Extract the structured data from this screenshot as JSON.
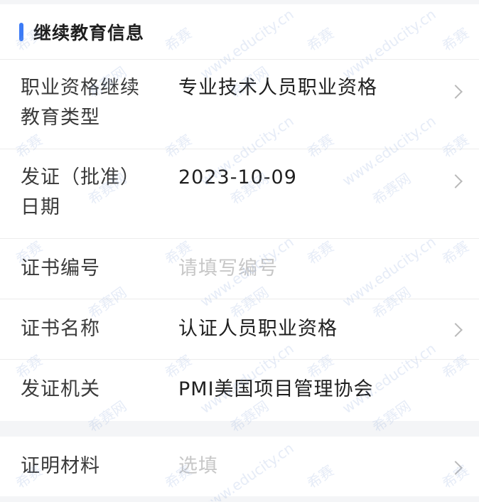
{
  "section": {
    "title": "继续教育信息"
  },
  "rows": [
    {
      "label_line1": "职业资格继续",
      "label_line2": "教育类型",
      "value": "专业技术人员职业资格",
      "has_chevron": true,
      "placeholder": false
    },
    {
      "label_line1": "发证（批准）",
      "label_line2": "日期",
      "value": "2023-10-09",
      "has_chevron": true,
      "placeholder": false
    },
    {
      "label_line1": "证书编号",
      "label_line2": "",
      "value": "请填写编号",
      "has_chevron": false,
      "placeholder": true
    },
    {
      "label_line1": "证书名称",
      "label_line2": "",
      "value": "认证人员职业资格",
      "has_chevron": true,
      "placeholder": false
    },
    {
      "label_line1": "发证机关",
      "label_line2": "",
      "value": "PMI美国项目管理协会",
      "has_chevron": false,
      "placeholder": false
    }
  ],
  "materials": {
    "label": "证明材料",
    "value": "选填",
    "has_chevron": true,
    "placeholder": true
  },
  "watermark": {
    "brand": "希赛",
    "site": "www.educity.cn",
    "net": "希赛网"
  },
  "colors": {
    "accent": "#3c7bf6",
    "placeholder": "#c7c7c7",
    "text": "#1f1f1f",
    "label": "#3a3a3a",
    "divider": "#ececec",
    "page_bg": "#f4f5f7"
  },
  "icons": {
    "row_chevron": "chevron-right-icon"
  }
}
